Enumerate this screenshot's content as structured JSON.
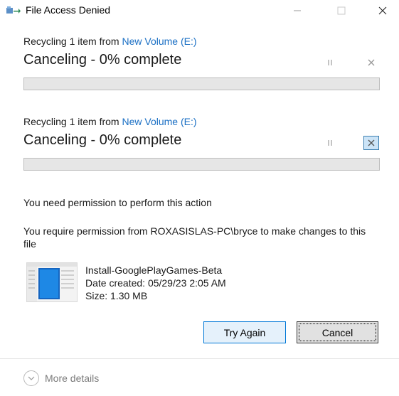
{
  "window": {
    "title": "File Access Denied",
    "app_icon": "move-folder-icon",
    "controls": [
      "minimize-icon",
      "maximize-icon",
      "close-icon"
    ]
  },
  "operations": [
    {
      "from_prefix": "Recycling 1 item from ",
      "from_location": "New Volume (E:)",
      "status": "Canceling - 0% complete",
      "progress": 0,
      "pause_icon": "pause-icon",
      "cancel_icon": "close-icon"
    },
    {
      "from_prefix": "Recycling 1 item from ",
      "from_location": "New Volume (E:)",
      "status": "Canceling - 0% complete",
      "progress": 0,
      "pause_icon": "pause-icon",
      "cancel_icon": "close-icon"
    }
  ],
  "permission": {
    "heading": "You need permission to perform this action",
    "detail": "You require permission from ROXASISLAS-PC\\bryce to make changes to this file"
  },
  "file": {
    "name": "Install-GooglePlayGames-Beta",
    "date_created": "Date created: 05/29/23 2:05 AM",
    "size": "Size: 1.30 MB",
    "thumbnail_icon": "installer-file-icon"
  },
  "buttons": {
    "try_again": "Try Again",
    "cancel": "Cancel"
  },
  "more_details": {
    "label": "More details",
    "icon": "chevron-down-icon"
  },
  "colors": {
    "link": "#1a6fc4",
    "progress_track": "#e6e6e6",
    "primary_button_border": "#0078d7",
    "cancel_active_bg": "#cce4f7"
  }
}
